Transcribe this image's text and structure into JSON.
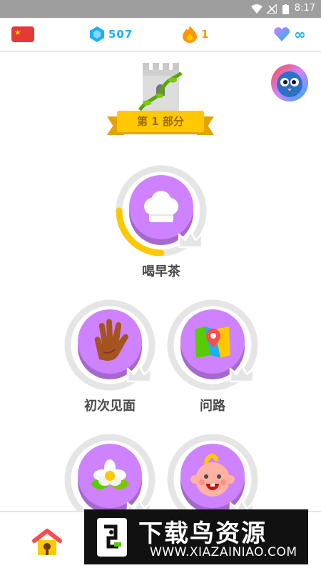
{
  "status_bar": {
    "time": "8:17"
  },
  "top_bar": {
    "language_flag": "china-flag-icon",
    "gems": "507",
    "streak": "1",
    "hearts": "∞",
    "gem_color": "#1cb0f6",
    "streak_color": "#ff9600"
  },
  "section": {
    "label": "第 1 部分"
  },
  "skills": [
    {
      "name": "喝早茶",
      "icon": "chef-hat-icon",
      "progress": 0.25
    },
    {
      "name": "初次见面",
      "icon": "waving-hand-icon",
      "progress": 0
    },
    {
      "name": "问路",
      "icon": "map-icon",
      "progress": 0
    },
    {
      "name": "",
      "icon": "flower-icon",
      "progress": 0
    },
    {
      "name": "",
      "icon": "baby-face-icon",
      "progress": 0
    }
  ],
  "colors": {
    "skill_purple": "#ce82ff",
    "progress_gold": "#ffc800",
    "ring_gray": "#e5e5e5"
  },
  "watermark": {
    "title": "下载鸟资源",
    "url": "WWW.XIAZAINIAO.COM"
  }
}
